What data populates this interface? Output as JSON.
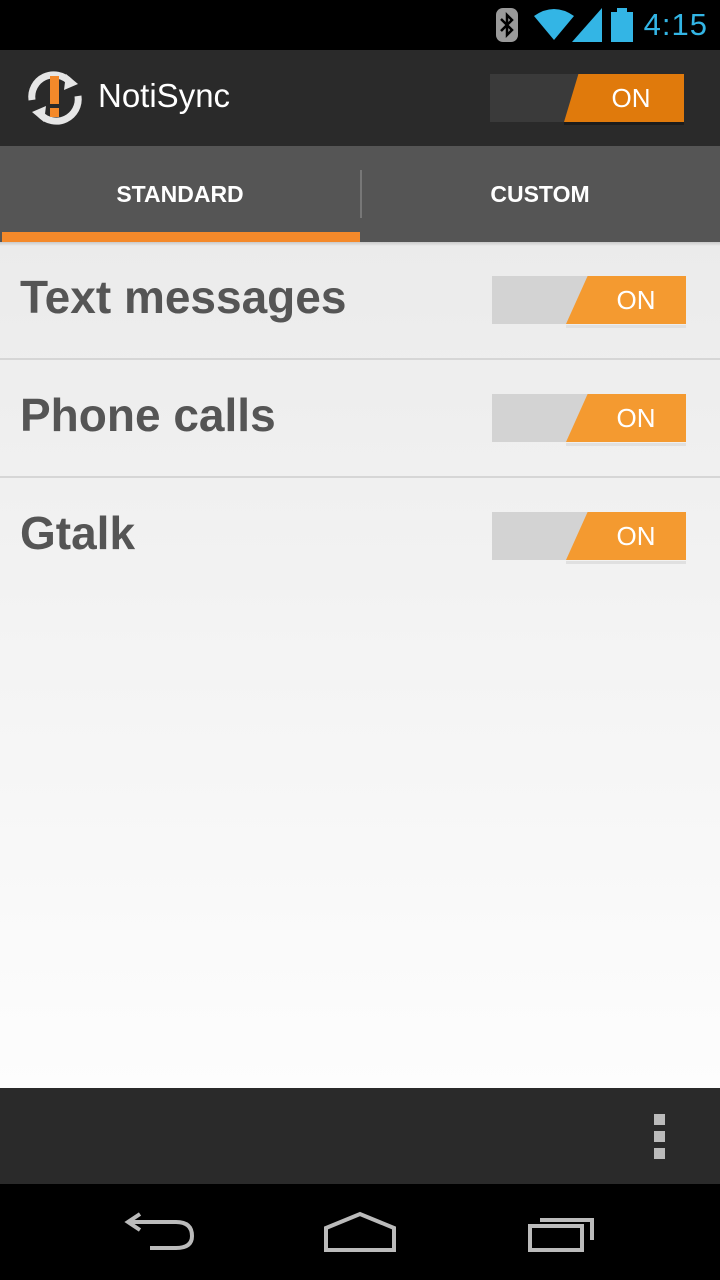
{
  "status_bar": {
    "time": "4:15",
    "icons": [
      "bluetooth-icon",
      "wifi-icon",
      "signal-icon",
      "battery-icon"
    ],
    "accent_color": "#33b5e5"
  },
  "action_bar": {
    "title": "NotiSync",
    "logo_icon": "notisync-logo",
    "master_toggle": {
      "label": "ON",
      "state": true
    }
  },
  "tabs": [
    {
      "label": "STANDARD",
      "selected": true
    },
    {
      "label": "CUSTOM",
      "selected": false
    }
  ],
  "settings": [
    {
      "label": "Text messages",
      "toggle_label": "ON",
      "state": true
    },
    {
      "label": "Phone calls",
      "toggle_label": "ON",
      "state": true
    },
    {
      "label": "Gtalk",
      "toggle_label": "ON",
      "state": true
    }
  ],
  "bottom_bar": {
    "overflow_icon": "overflow-menu-icon"
  },
  "nav_bar": {
    "icons": [
      "back-icon",
      "home-icon",
      "recent-apps-icon"
    ]
  },
  "colors": {
    "accent": "#f4892a",
    "toggle_on": "#f49a30",
    "action_bar_bg": "#2a2a2a",
    "tab_bg": "#555555"
  }
}
